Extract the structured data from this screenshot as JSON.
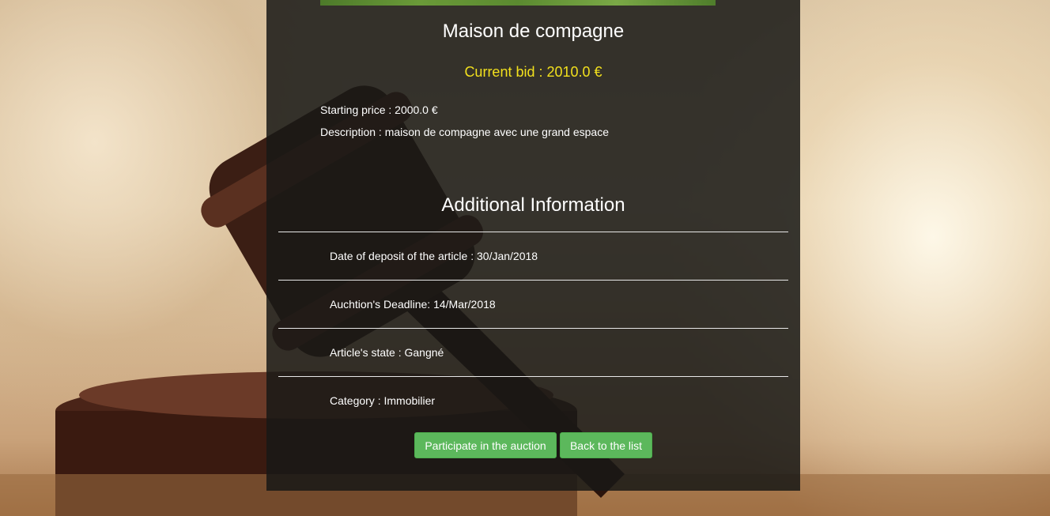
{
  "article": {
    "title": "Maison de compagne",
    "current_bid": "Current bid : 2010.0 €",
    "starting_price": "Starting price : 2000.0 €",
    "description": "Description : maison de compagne avec une grand espace"
  },
  "additional": {
    "heading": "Additional Information",
    "deposit_date": "Date of deposit of the article : 30/Jan/2018",
    "deadline": "Auchtion's Deadline: 14/Mar/2018",
    "state": "Article's state : Gangné",
    "category": "Category : Immobilier"
  },
  "actions": {
    "participate_label": "Participate in the auction",
    "back_label": "Back to the list"
  },
  "colors": {
    "bid": "#f2e01d",
    "button": "#5cb85c",
    "panel": "#191916"
  }
}
